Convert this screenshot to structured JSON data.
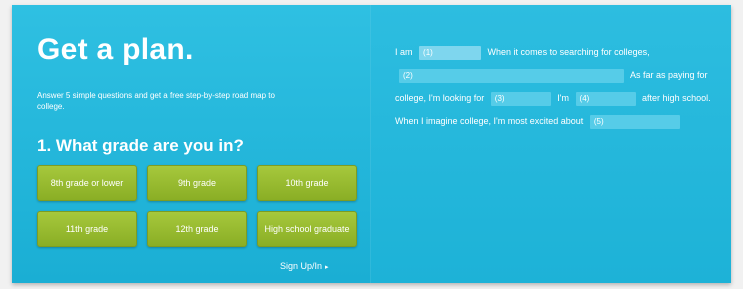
{
  "left": {
    "title": "Get a plan.",
    "subtitle": "Answer 5 simple questions and get a free step-by-step road map to college.",
    "question": "1. What grade are you in?",
    "grades": [
      "8th grade or lower",
      "9th grade",
      "10th grade",
      "11th grade",
      "12th grade",
      "High school graduate"
    ],
    "signin_label": "Sign Up/In",
    "signin_arrow": "▸"
  },
  "right": {
    "t1": "I am",
    "b1": "(1)",
    "t2": "When it comes to searching for colleges,",
    "b2": "(2)",
    "t3": "As far as paying for college, I'm looking for",
    "b3": "(3)",
    "t4": "I'm",
    "b4": "(4)",
    "t5": "after high school. When I imagine college, I'm most excited about",
    "b5": "(5)"
  }
}
